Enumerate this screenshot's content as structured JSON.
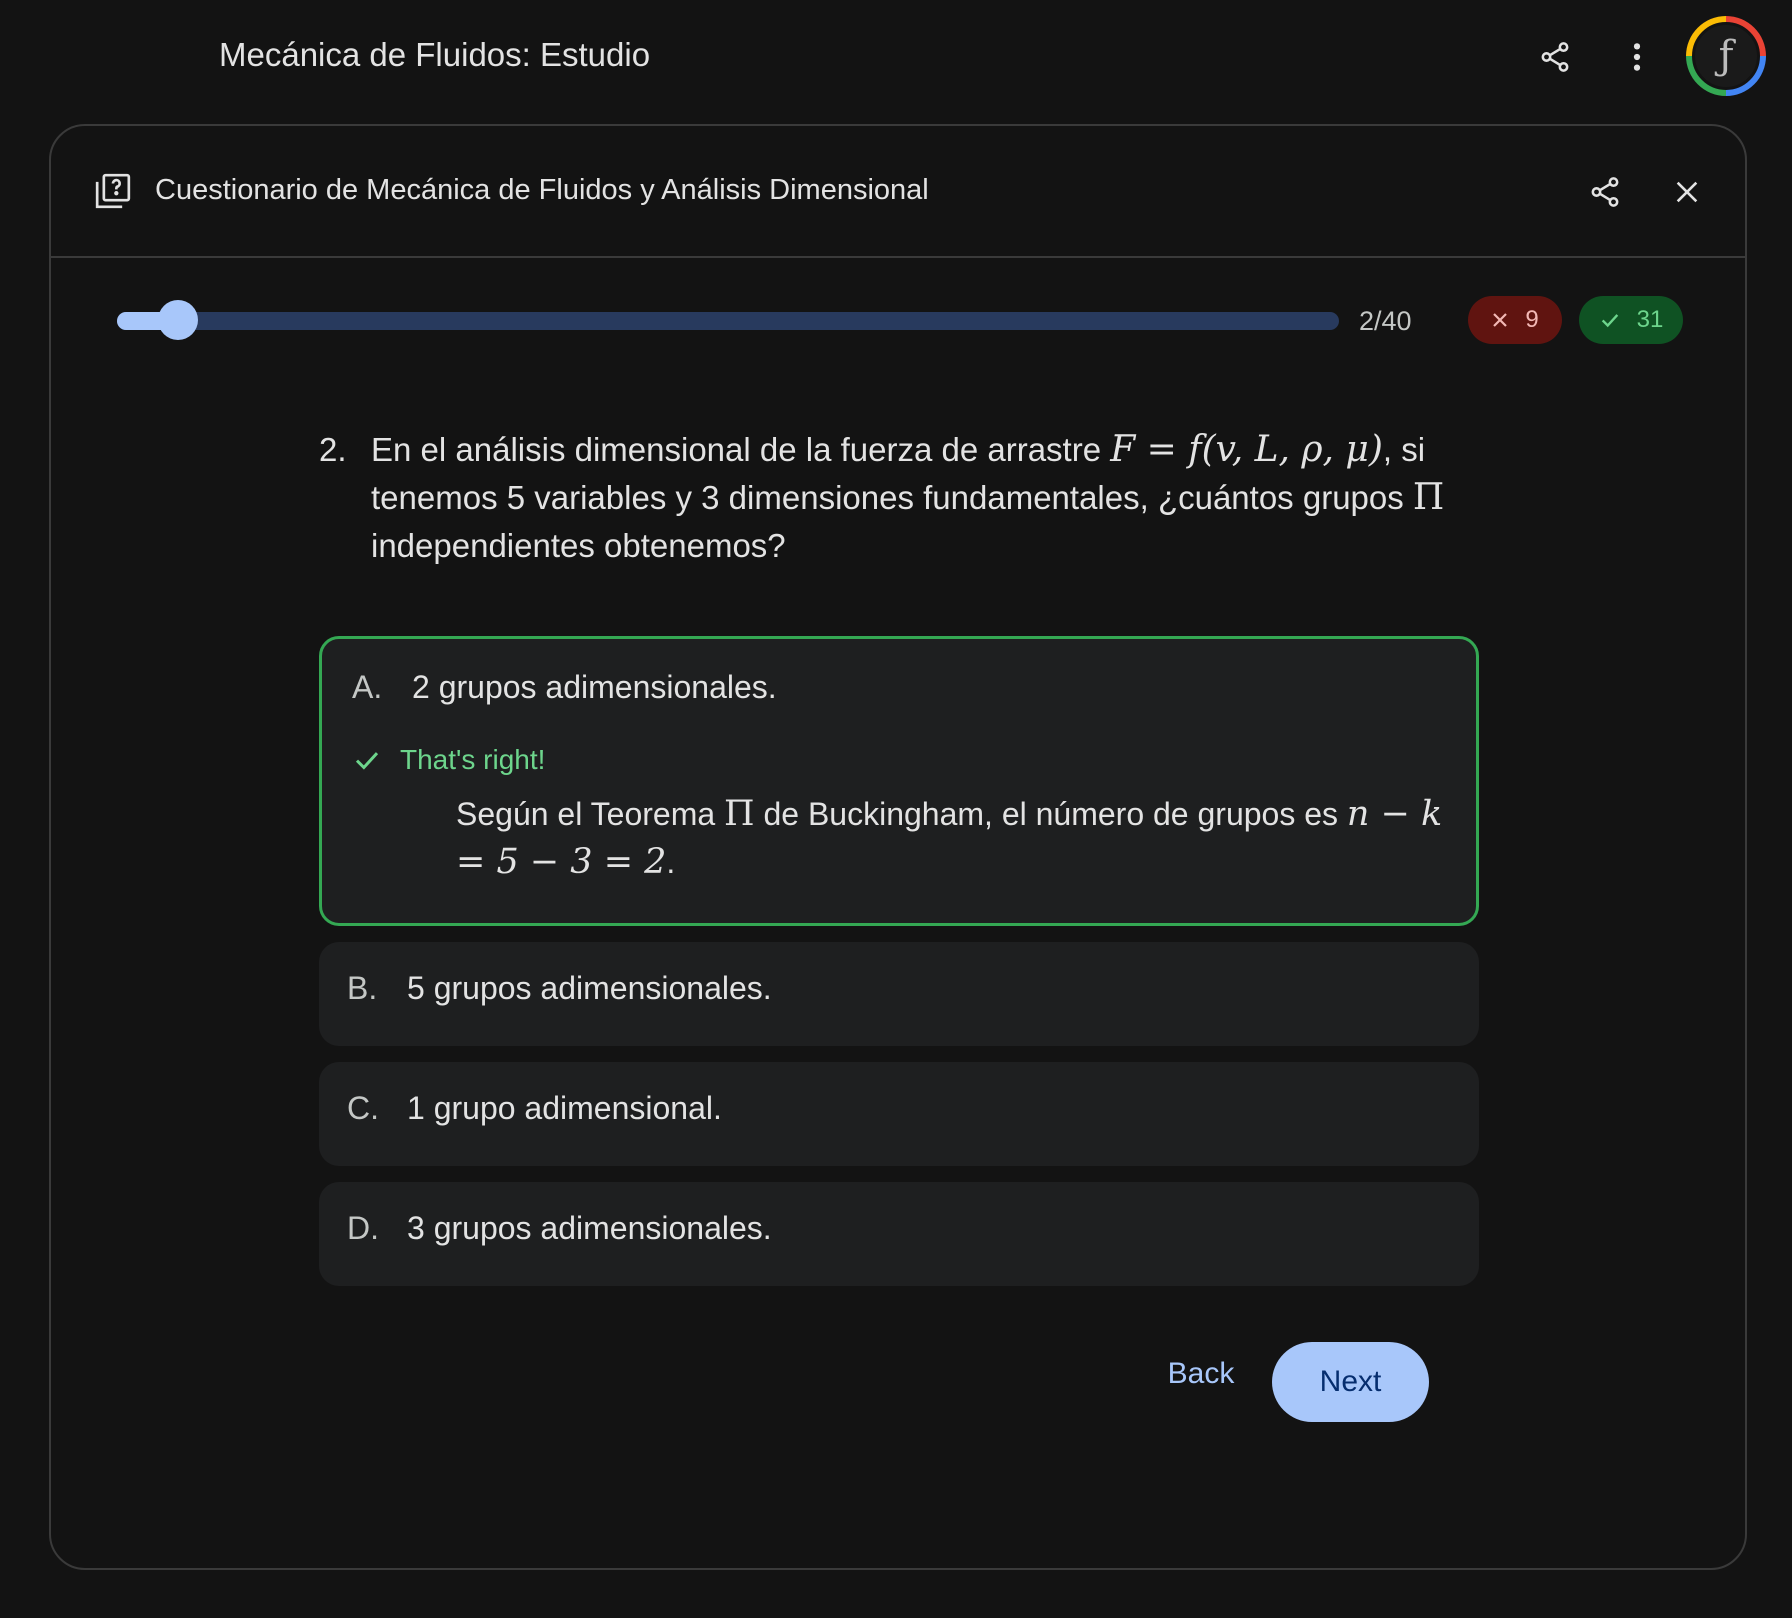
{
  "app": {
    "title": "Mecánica de Fluidos: Estudio",
    "avatar_letter": "ƒ"
  },
  "panel": {
    "title": "Cuestionario de Mecánica de Fluidos y Análisis Dimensional",
    "progress_label": "2/40",
    "progress_fraction": 0.05,
    "wrong_count": "9",
    "right_count": "31"
  },
  "question": {
    "number": "2.",
    "text_before": "En el análisis dimensional de la fuerza de arrastre ",
    "math_eq": "F = f(v, L, ρ, μ)",
    "text_middle": ", si tenemos 5 variables y 3 dimensiones fundamentales, ¿cuántos grupos ",
    "pi": "Π",
    "text_after": " independientes obtenemos?"
  },
  "options": [
    {
      "letter": "A.",
      "text": "2 grupos adimensionales.",
      "feedback": "That's right!",
      "explanation_before": "Según el Teorema ",
      "explanation_pi": "Π",
      "explanation_middle": " de Buckingham, el número de grupos es ",
      "explanation_math": "n − k = 5 − 3 = 2",
      "explanation_end": "."
    },
    {
      "letter": "B.",
      "text": "5 grupos adimensionales."
    },
    {
      "letter": "C.",
      "text": "1 grupo adimensional."
    },
    {
      "letter": "D.",
      "text": "3 grupos adimensionales."
    }
  ],
  "buttons": {
    "back": "Back",
    "next": "Next"
  },
  "colors": {
    "accent": "#a8c7fa",
    "correct": "#34a853",
    "wrong_badge": "#601410",
    "right_badge": "#0f5223"
  },
  "icons": {
    "share": "share-icon",
    "more": "more-vert-icon",
    "close": "close-icon",
    "quiz": "quiz-icon",
    "check": "check-icon"
  }
}
